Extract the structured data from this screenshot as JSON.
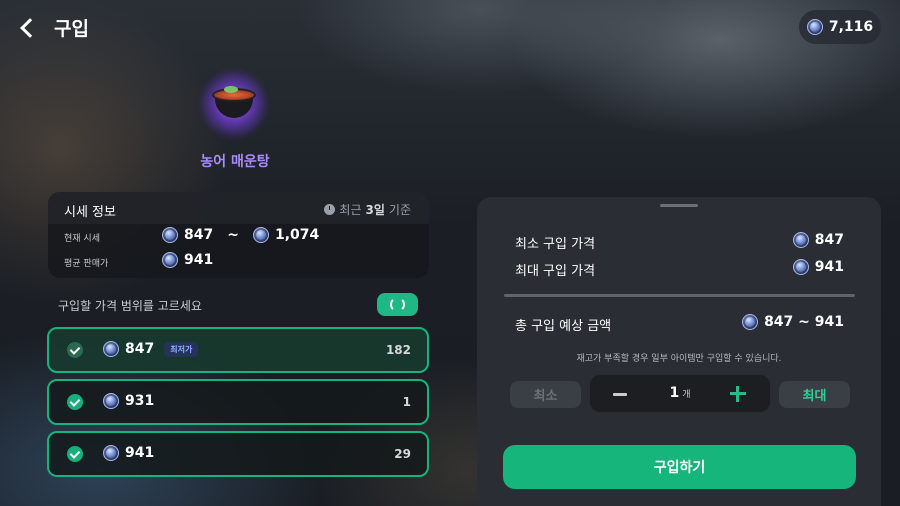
{
  "header": {
    "title": "구입",
    "back_icon": "chevron-left-icon",
    "balance": "7,116"
  },
  "item": {
    "name": "농어 매운탕",
    "name_color": "#a98bff"
  },
  "price_info": {
    "title": "시세 정보",
    "recent_prefix": "최근 ",
    "recent_days": "3일",
    "recent_suffix": " 기준",
    "current_label": "현재 시세",
    "current_min": "847",
    "tilde": "~",
    "current_max": "1,074",
    "average_label": "평균 판매가",
    "average": "941"
  },
  "range": {
    "label": "구입할 가격 범위를 고르세요",
    "options": [
      {
        "price": "847",
        "badge": "최저가",
        "qty": "182"
      },
      {
        "price": "931",
        "qty": "1"
      },
      {
        "price": "941",
        "qty": "29"
      }
    ]
  },
  "panel": {
    "min_price_label": "최소 구입 가격",
    "min_price": "847",
    "max_price_label": "최대 구입 가격",
    "max_price": "941",
    "total_label": "총 구입 예상 금액",
    "total": "847 ~ 941",
    "notice": "재고가 부족할 경우 일부 아이템만 구입할 수 있습니다.",
    "min_btn": "최소",
    "quantity": "1",
    "quantity_unit": "개",
    "max_btn": "최대",
    "buy_btn": "구입하기"
  },
  "colors": {
    "accent": "#16b57c",
    "item_name": "#a98bff"
  }
}
